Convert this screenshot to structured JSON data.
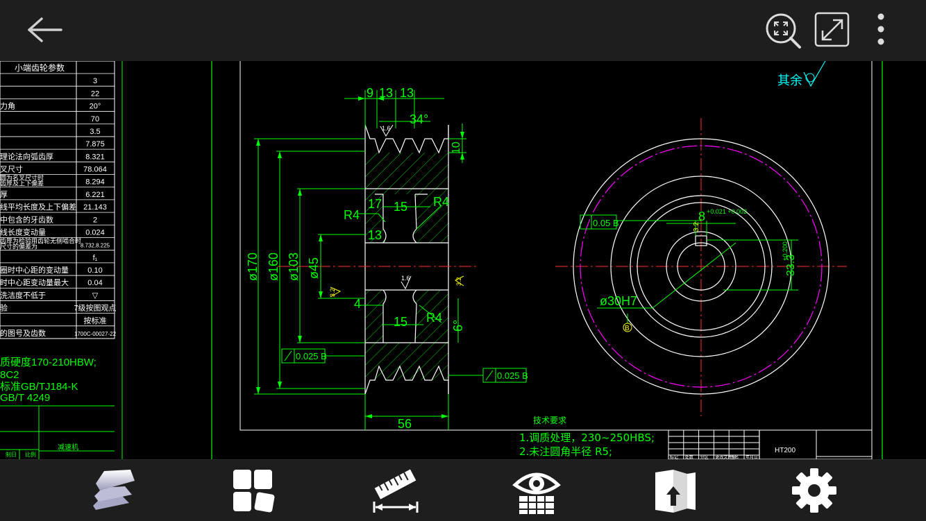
{
  "toolbar": {
    "back_icon": "arrow-left-icon",
    "zoom_fit_icon": "zoom-fit-icon",
    "fullscreen_icon": "expand-icon",
    "more_icon": "more-vertical-icon"
  },
  "bottom_toolbar": {
    "items": [
      {
        "icon": "layers-icon"
      },
      {
        "icon": "blocks-icon"
      },
      {
        "icon": "measure-icon"
      },
      {
        "icon": "view-grid-eye-icon"
      },
      {
        "icon": "export-icon"
      },
      {
        "icon": "gear-icon"
      }
    ]
  },
  "drawing": {
    "colors": {
      "lines": "#00ff00",
      "dims": "#00ff00",
      "outline": "#ffffff",
      "center": "#ff2a2a",
      "magenta": "#ff00ff",
      "text": "#00ff00",
      "yellow": "#ffff00",
      "cyan": "#00ffff"
    },
    "param_table": {
      "title": "小端齿轮参数",
      "rows": [
        {
          "label": "",
          "value": "3"
        },
        {
          "label": "",
          "value": "22"
        },
        {
          "label": "力角",
          "value": "20°"
        },
        {
          "label": "",
          "value": "70"
        },
        {
          "label": "",
          "value": "3.5"
        },
        {
          "label": "",
          "value": "7.875"
        },
        {
          "label": "理论法向弧齿厚",
          "value": "8.321"
        },
        {
          "label": "叉尺寸",
          "value": "78.064"
        },
        {
          "label": "圆为名叉尺寸时\n齿厚及上下偏差",
          "value": "8.294"
        },
        {
          "label": "厚",
          "value": "6.221"
        },
        {
          "label": "线平均长度及上下偏差",
          "value": "21.143"
        },
        {
          "label": "中包含的牙齿数",
          "value": "2"
        },
        {
          "label": "线长度变动量",
          "value": "0.024"
        },
        {
          "label": "齿厚为检验用齿轮无侧啮合时\n尺寸的偏差为",
          "value": "8.732,8.225"
        },
        {
          "label": "",
          "value": "f₁"
        },
        {
          "label": "圈时中心距的变动量",
          "value": "0.10"
        },
        {
          "label": "时中心距变动量最大",
          "value": "0.04"
        },
        {
          "label": "洗洁度不低于",
          "value": "▽"
        },
        {
          "label": "验",
          "value": "7级按图观点"
        },
        {
          "label": "",
          "value": "按标准"
        },
        {
          "label": "的图号及齿数",
          "value": "1700C-00027-22"
        }
      ]
    },
    "left_notes": [
      "质硬度170-210HBW;",
      "8C2",
      "标准GB/TJ184-K",
      "GB/T 4249"
    ],
    "left_block_label": "减速机",
    "left_block_cells": [
      "制",
      "日",
      "比例"
    ],
    "surface_mark": "其余",
    "dims": {
      "top_9": "9",
      "top_13a": "13",
      "top_13b": "13",
      "angle": "34°",
      "depth_10": "10",
      "dia_170": "ø170",
      "dia_160": "ø160",
      "dia_103": "ø103",
      "dia_45": "ø45",
      "r4_left": "R4",
      "r4_right": "R4",
      "r4_bottom": "R4",
      "d17": "17",
      "d15a": "15",
      "d13": "13",
      "d15b": "15",
      "d4": "4",
      "d6": "6°",
      "d56": "56",
      "rough_16a": "1.6",
      "rough_16b": "1.6",
      "rough_32a": "3.2",
      "rough_32b": "3.2",
      "tol_left": "0.025 B",
      "tol_right": "0.025 B",
      "tol_circle": "0.05 B",
      "keyway_w": "8",
      "keyway_tol": "+0.021\n+0.002",
      "keyway_h": "33.3",
      "keyway_h_tol": "+0.200",
      "bore": "ø30H7",
      "datum": "B"
    },
    "tech_req": {
      "title": "技术要求",
      "lines": [
        "1.调质处理，230~250HBS;",
        "2.未注圆角半径 R5;"
      ]
    },
    "title_block": {
      "material": "HT200",
      "row_labels": [
        "标记",
        "处数",
        "分区",
        "更改文件号",
        "签名",
        "年月日"
      ]
    }
  }
}
